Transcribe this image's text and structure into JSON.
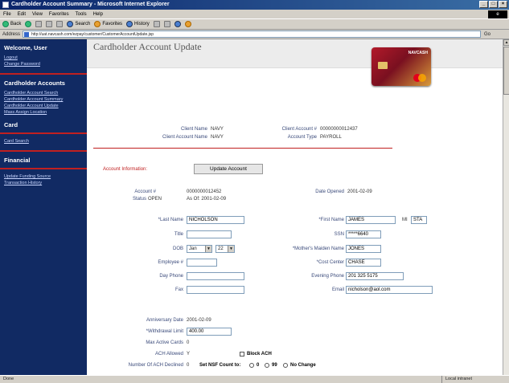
{
  "window": {
    "title": "Cardholder Account Summary - Microsoft Internet Explorer",
    "controls": [
      "_",
      "□",
      "×"
    ]
  },
  "menubar": {
    "items": [
      "File",
      "Edit",
      "View",
      "Favorites",
      "Tools",
      "Help"
    ]
  },
  "toolbar": {
    "back": "Back",
    "search": "Search",
    "favorites": "Favorites",
    "history": "History"
  },
  "address": {
    "label": "Address",
    "url": "http://uat.navcash.com/ezpay/customer/CustomerAccountUpdate.jsp",
    "go": "Go"
  },
  "sidebar": {
    "welcome": "Welcome, User",
    "user_links": [
      "Logout",
      "Change Password"
    ],
    "cardholder_heading": "Cardholder Accounts",
    "cardholder_links": [
      "Cardholder Account Search",
      "Cardholder Account Summary",
      "Cardholder Account Update",
      "Mass Assign Location"
    ],
    "card_heading": "Card",
    "card_links": [
      "Card Search"
    ],
    "financial_heading": "Financial",
    "financial_links": [
      "Update Funding Source",
      "Transaction History"
    ]
  },
  "page": {
    "title": "Cardholder Account Update",
    "card_brand": "NAVCASH"
  },
  "client": {
    "client_name_label": "Client Name",
    "client_name": "NAVY",
    "client_account_name_label": "Client Account Name",
    "client_account_name": "NAVY",
    "client_account_no_label": "Client Account #",
    "client_account_no": "00000000012437",
    "account_type_label": "Account Type",
    "account_type": "PAYROLL"
  },
  "form": {
    "account_info_label": "Account Information:",
    "update_button": "Update Account",
    "account_no_label": "Account #",
    "account_no": "0000000012452",
    "status_label": "Status",
    "status": "OPEN",
    "as_of": "As Of: 2001-02-09",
    "date_opened_label": "Date Opened",
    "date_opened": "2001-02-09",
    "last_name_label": "*Last Name",
    "last_name": "NICHOLSON",
    "first_name_label": "*First Name",
    "first_name": "JAMES",
    "mi_label": "MI",
    "mi": "STA",
    "title_label": "Title",
    "title": "",
    "ssn_label": "SSN",
    "ssn": "*****6640",
    "dob_label": "DOB",
    "dob_month": "Jan",
    "dob_day": "22",
    "mothers_maiden_label": "*Mother's Maiden Name",
    "mothers_maiden": "JONES",
    "employee_label": "Employee #",
    "employee": "",
    "cost_center_label": "*Cost Center",
    "cost_center": "CHASE",
    "day_phone_label": "Day Phone",
    "day_phone": "",
    "evening_phone_label": "Evening Phone",
    "evening_phone": "201 325 5175",
    "fax_label": "Fax",
    "fax": "",
    "email_label": "Email",
    "email": "nicholson@aol.com",
    "anniversary_label": "Anniversary Date",
    "anniversary": "2001-02-09",
    "withdrawal_label": "*Withdrawal Limit",
    "withdrawal": "400.00",
    "max_cards_label": "Max Active Cards",
    "max_cards": "0",
    "ach_allowed_label": "ACH Allowed",
    "ach_allowed": "Y",
    "block_ach_label": "Block ACH",
    "ach_declined_label": "Number Of ACH Declined",
    "ach_declined": "0",
    "nsf_label": "Set NSF Count to:",
    "nsf_opt1": "0",
    "nsf_opt2": "99",
    "nsf_opt3": "No Change"
  },
  "status_bar": {
    "left": "Done",
    "zone": "Local intranet"
  }
}
